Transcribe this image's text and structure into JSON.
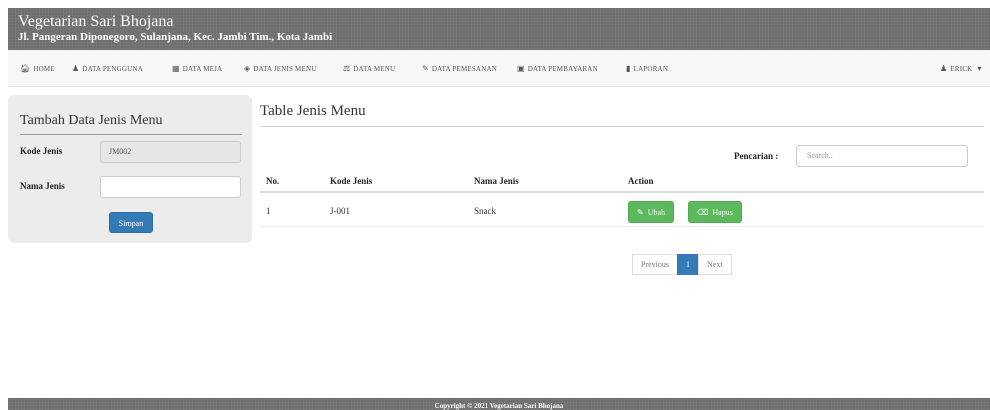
{
  "header": {
    "title": "Vegetarian Sari Bhojana",
    "address": "Jl. Pangeran Diponegoro, Sulanjana, Kec. Jambi Tim., Kota Jambi"
  },
  "nav": {
    "items": [
      {
        "label": "HOME",
        "icon": "home-icon"
      },
      {
        "label": "DATA PENGGUNA",
        "icon": "user-icon"
      },
      {
        "label": "DATA MEJA",
        "icon": "table-icon"
      },
      {
        "label": "DATA JENIS MENU",
        "icon": "tag-icon"
      },
      {
        "label": "DATA MENU",
        "icon": "cutlery-icon"
      },
      {
        "label": "DATA PEMESANAN",
        "icon": "pencil-icon"
      },
      {
        "label": "DATA PEMBAYARAN",
        "icon": "cash-icon"
      },
      {
        "label": "LAPORAN",
        "icon": "file-icon"
      }
    ],
    "user": {
      "label": "ERICK",
      "icon": "user-icon"
    }
  },
  "form": {
    "title": "Tambah Data Jenis Menu",
    "kode_label": "Kode Jenis",
    "kode_value": "JM002",
    "nama_label": "Nama Jenis",
    "nama_value": "",
    "submit_label": "Simpan"
  },
  "table": {
    "title": "Table Jenis Menu",
    "search_label": "Pencarian :",
    "search_placeholder": "Search..",
    "headers": [
      "No.",
      "Kode Jenis",
      "Nama Jenis",
      "Action"
    ],
    "rows": [
      {
        "no": "1",
        "kode": "J-001",
        "nama": "Snack",
        "edit_label": "Ubah",
        "delete_label": "Hapus"
      }
    ]
  },
  "pagination": {
    "previous": "Previous",
    "current": "1",
    "next": "Next"
  },
  "footer": {
    "text": "Copyright © 2021 Vegetarian Sari Bhojana"
  },
  "colors": {
    "header_bg": "#6f6f6f",
    "primary": "#337ab7",
    "success": "#5cb85c"
  }
}
